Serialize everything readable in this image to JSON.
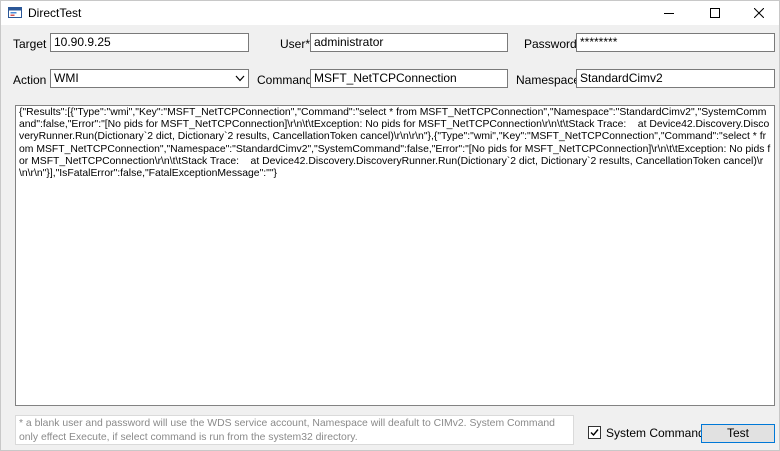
{
  "window": {
    "title": "DirectTest"
  },
  "form": {
    "target_label": "Target",
    "target_value": "10.90.9.25",
    "user_label": "User*",
    "user_value": "administrator",
    "password_label": "Password*",
    "password_value": "********",
    "action_label": "Action",
    "action_value": "WMI",
    "command_label": "Command",
    "command_value": "MSFT_NetTCPConnection",
    "namespace_label": "Namespace*",
    "namespace_value": "StandardCimv2"
  },
  "results": {
    "text": "{\"Results\":[{\"Type\":\"wmi\",\"Key\":\"MSFT_NetTCPConnection\",\"Command\":\"select * from MSFT_NetTCPConnection\",\"Namespace\":\"StandardCimv2\",\"SystemCommand\":false,\"Error\":\"[No pids for MSFT_NetTCPConnection]\\r\\n\\t\\tException: No pids for MSFT_NetTCPConnection\\r\\n\\t\\tStack Trace:    at Device42.Discovery.DiscoveryRunner.Run(Dictionary`2 dict, Dictionary`2 results, CancellationToken cancel)\\r\\n\\r\\n\"},{\"Type\":\"wmi\",\"Key\":\"MSFT_NetTCPConnection\",\"Command\":\"select * from MSFT_NetTCPConnection\",\"Namespace\":\"StandardCimv2\",\"SystemCommand\":false,\"Error\":\"[No pids for MSFT_NetTCPConnection]\\r\\n\\t\\tException: No pids for MSFT_NetTCPConnection\\r\\n\\t\\tStack Trace:    at Device42.Discovery.DiscoveryRunner.Run(Dictionary`2 dict, Dictionary`2 results, CancellationToken cancel)\\r\\n\\r\\n\"}],\"IsFatalError\":false,\"FatalExceptionMessage\":\"\"}"
  },
  "footer": {
    "note": "* a blank user and password will use the WDS service account, Namespace will deafult to CIMv2. System Command only effect Execute, if select command is run from the system32 directory.",
    "system_command_label": "System Command*",
    "system_command_checked": true,
    "test_button_label": "Test"
  }
}
